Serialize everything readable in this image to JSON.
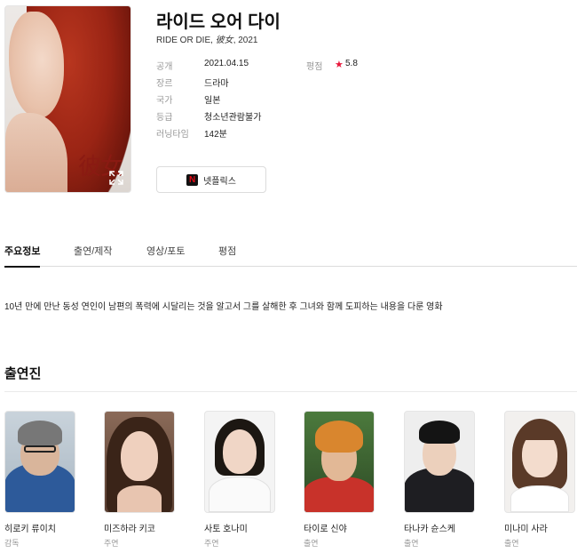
{
  "movie": {
    "title": "라이드 오어 다이",
    "subtitle_prefix": "RIDE OR DIE, ",
    "subtitle_italic": "彼女",
    "subtitle_suffix": ", 2021",
    "poster_text": "彼女"
  },
  "info": [
    {
      "key": "공개",
      "value": "2021.04.15"
    },
    {
      "key": "장르",
      "value": "드라마"
    },
    {
      "key": "국가",
      "value": "일본"
    },
    {
      "key": "등급",
      "value": "청소년관람불가"
    },
    {
      "key": "러닝타임",
      "value": "142분"
    }
  ],
  "rating": {
    "key": "평점",
    "value": "5.8",
    "star_color": "#e8163a"
  },
  "netflix": {
    "label": "넷플릭스",
    "icon_letter": "N",
    "icon_color": "#e50914"
  },
  "tabs": [
    {
      "label": "주요정보",
      "active": true
    },
    {
      "label": "출연/제작",
      "active": false
    },
    {
      "label": "영상/포토",
      "active": false
    },
    {
      "label": "평점",
      "active": false
    }
  ],
  "synopsis": "10년 만에 만난 동성 연인이 남편의 폭력에 시달리는 것을 알고서 그를 살해한 후 그녀와 함께 도피하는 내용을 다룬 영화",
  "cast_section": {
    "title": "출연진"
  },
  "cast": [
    {
      "name": "히로키 류이치",
      "role": "감독",
      "photo": "man-glasses-beanie"
    },
    {
      "name": "미즈하라 키코",
      "role": "주연",
      "photo": "woman-long-hair"
    },
    {
      "name": "사토 호나미",
      "role": "주연",
      "photo": "woman-bob-hair"
    },
    {
      "name": "타이로 신야",
      "role": "출연",
      "photo": "man-orange-hair"
    },
    {
      "name": "타나카 슌스케",
      "role": "출연",
      "photo": "man-dark-suit"
    },
    {
      "name": "미나미 사라",
      "role": "출연",
      "photo": "woman-bangs"
    }
  ]
}
